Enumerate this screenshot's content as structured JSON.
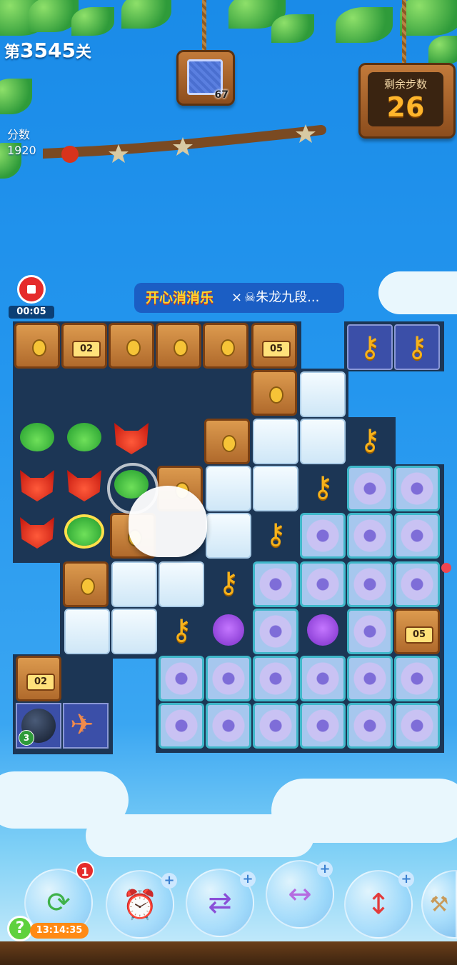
{
  "header": {
    "level_prefix": "第",
    "level_number": "3545",
    "level_suffix": "关",
    "score_label": "分数",
    "score_value": "1920",
    "goal_count": "67",
    "moves_label": "剩余步数",
    "moves_value": "26"
  },
  "recording": {
    "timer": "00:05"
  },
  "banner": {
    "logo_text": "开心消消乐",
    "separator": "×",
    "partner_text": "☠朱龙九段..."
  },
  "board": {
    "crate_numbers": {
      "a": "02",
      "b": "05",
      "c": "05",
      "d": "02"
    },
    "special_counter": "3"
  },
  "boosters": {
    "badge_count": "1",
    "countdown": "13:14:35",
    "help_label": "?",
    "plus_label": "+",
    "icons": [
      "refresh-board-icon",
      "clock-icon",
      "swap-animals-icon",
      "line-rocket-icon",
      "vertical-rocket-icon",
      "hammer-icon"
    ]
  },
  "colors": {
    "sky": "#2496ee",
    "board": "#1c3655",
    "accent": "#ffb52b"
  }
}
